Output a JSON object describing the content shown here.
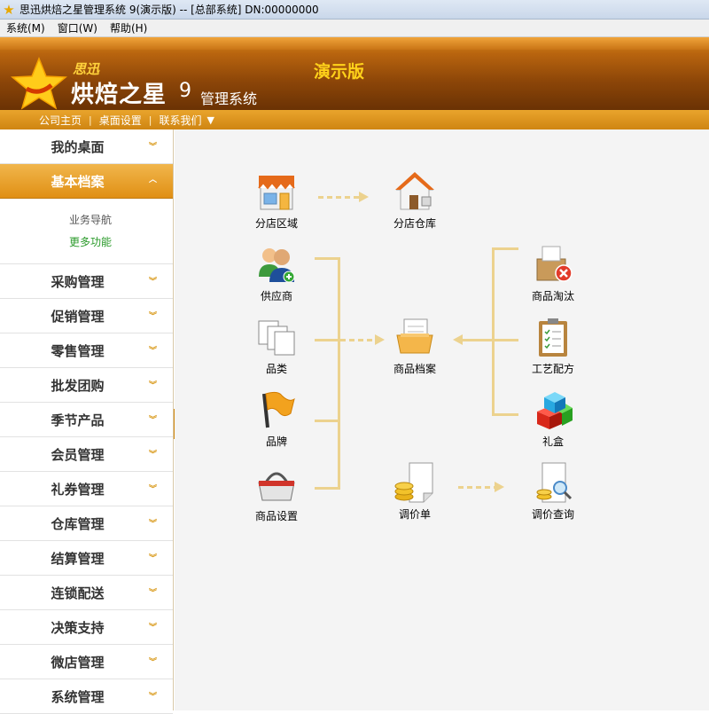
{
  "window": {
    "title": "思迅烘焙之星管理系统 9(演示版) -- [总部系统] DN:00000000"
  },
  "menu": [
    "系统(M)",
    "窗口(W)",
    "帮助(H)"
  ],
  "brand": {
    "top": "思迅",
    "name": "烘焙之星",
    "version": "9",
    "suffix": "管理系统",
    "edition": "演示版"
  },
  "nav": {
    "home": "公司主页",
    "desk": "桌面设置",
    "contact": "联系我们"
  },
  "sidebar": {
    "top_items": [
      "我的桌面",
      "基本档案"
    ],
    "sub": {
      "guide": "业务导航",
      "more": "更多功能"
    },
    "items": [
      "采购管理",
      "促销管理",
      "零售管理",
      "批发团购",
      "季节产品",
      "会员管理",
      "礼券管理",
      "仓库管理",
      "结算管理",
      "连锁配送",
      "决策支持",
      "微店管理",
      "系统管理"
    ]
  },
  "flow": {
    "branch_area": "分店区域",
    "branch_store": "分店仓库",
    "supplier": "供应商",
    "category": "品类",
    "brand": "品牌",
    "product_setup": "商品设置",
    "product_file": "商品档案",
    "price_adjust": "调价单",
    "retire": "商品淘汰",
    "recipe": "工艺配方",
    "gift_box": "礼盒",
    "price_query": "调价查询"
  }
}
